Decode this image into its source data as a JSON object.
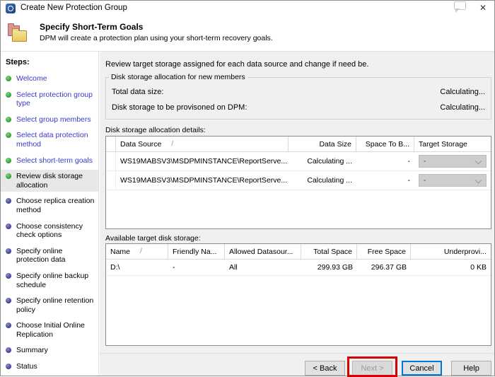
{
  "window": {
    "title": "Create New Protection Group"
  },
  "icons": {
    "close": "✕",
    "sort_ascending": "/"
  },
  "colors": {
    "accent_blue": "#0078d7",
    "link_blue": "#3939c8",
    "step_done_green": "#2f9e38",
    "step_pending_purple": "#3f3f96",
    "annotation_red": "#d40000"
  },
  "header": {
    "title": "Specify Short-Term Goals",
    "subtitle": "DPM will create a protection plan using your short-term recovery goals."
  },
  "sidebar": {
    "heading": "Steps:",
    "items": [
      {
        "label": "Welcome",
        "state": "done"
      },
      {
        "label": "Select protection group type",
        "state": "done"
      },
      {
        "label": "Select group members",
        "state": "done"
      },
      {
        "label": "Select data protection method",
        "state": "done"
      },
      {
        "label": "Select short-term goals",
        "state": "done"
      },
      {
        "label": "Review disk storage allocation",
        "state": "current"
      },
      {
        "label": "Choose replica creation method",
        "state": "pending"
      },
      {
        "label": "Choose consistency check options",
        "state": "pending"
      },
      {
        "label": "Specify online protection data",
        "state": "pending"
      },
      {
        "label": "Specify online backup schedule",
        "state": "pending"
      },
      {
        "label": "Specify online retention policy",
        "state": "pending"
      },
      {
        "label": "Choose Initial Online Replication",
        "state": "pending"
      },
      {
        "label": "Summary",
        "state": "pending"
      },
      {
        "label": "Status",
        "state": "pending"
      }
    ]
  },
  "main": {
    "intro": "Review target storage assigned for each data source and change if need be.",
    "allocation_group": {
      "legend": "Disk storage allocation for new members",
      "rows": [
        {
          "label": "Total data size:",
          "value": "Calculating..."
        },
        {
          "label": "Disk storage to be provisoned on DPM:",
          "value": "Calculating..."
        }
      ]
    },
    "details": {
      "label": "Disk storage allocation details:",
      "columns": [
        "Data Source",
        "Data Size",
        "Space To B...",
        "Target Storage"
      ],
      "rows": [
        {
          "data_source": "WS19MABSV3\\MSDPMINSTANCE\\ReportServe...",
          "data_size": "Calculating ...",
          "space_to_b": "-",
          "target_storage": "-"
        },
        {
          "data_source": "WS19MABSV3\\MSDPMINSTANCE\\ReportServe...",
          "data_size": "Calculating ...",
          "space_to_b": "-",
          "target_storage": "-"
        }
      ]
    },
    "available": {
      "label": "Available target disk storage:",
      "columns": [
        "Name",
        "Friendly Na...",
        "Allowed Datasour...",
        "Total Space",
        "Free Space",
        "Underprovi..."
      ],
      "rows": [
        {
          "name": "D:\\",
          "friendly_name": "-",
          "allowed_datasources": "All",
          "total_space": "299.93 GB",
          "free_space": "296.37 GB",
          "underprovisioned": "0 KB"
        }
      ]
    }
  },
  "footer": {
    "back_label": "< Back",
    "next_label": "Next >",
    "cancel_label": "Cancel",
    "help_label": "Help"
  }
}
